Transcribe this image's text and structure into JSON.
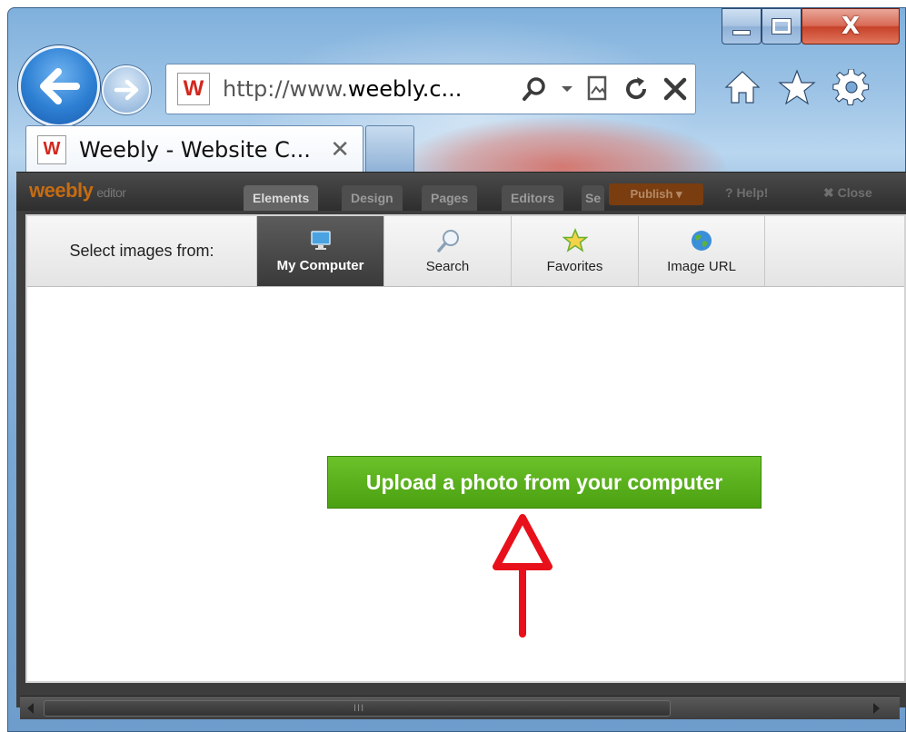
{
  "browser": {
    "address": {
      "url_prefix": "http://www.",
      "url_domain": "weebly.c...",
      "favicon": "W"
    },
    "tab": {
      "title": "Weebly - Website C...",
      "close_glyph": "✕",
      "favicon": "W"
    },
    "caption": {
      "close_glyph": "X"
    }
  },
  "editor": {
    "logo": "weebly",
    "logo_suffix": "editor",
    "tabs": [
      {
        "label": "Elements"
      },
      {
        "label": "Design"
      },
      {
        "label": "Pages"
      },
      {
        "label": "Editors"
      },
      {
        "label": "Se"
      }
    ],
    "publish_label": "Publish ▾",
    "help_label": "? Help!",
    "close_label": "✖ Close"
  },
  "dialog": {
    "select_label": "Select images from:",
    "sources": [
      {
        "label": "My Computer",
        "icon": "monitor-icon"
      },
      {
        "label": "Search",
        "icon": "magnifier-icon"
      },
      {
        "label": "Favorites",
        "icon": "star-icon"
      },
      {
        "label": "Image URL",
        "icon": "globe-icon"
      }
    ],
    "upload_button": "Upload a photo from your computer"
  },
  "scrollbar": {
    "grip": "III"
  },
  "colors": {
    "upload_green": "#4aa010",
    "arrow_red": "#e8101a",
    "weebly_orange": "#c66c12"
  }
}
